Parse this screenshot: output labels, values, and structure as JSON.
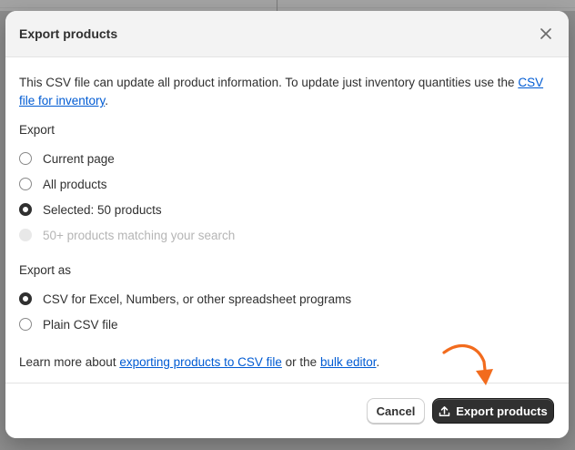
{
  "modal": {
    "title": "Export products",
    "close_icon": "close-icon"
  },
  "intro": {
    "text": "This CSV file can update all product information. To update just inventory quantities use the ",
    "link": "CSV file for inventory",
    "suffix": "."
  },
  "export": {
    "label": "Export",
    "options": [
      {
        "label": "Current page",
        "checked": false,
        "disabled": false
      },
      {
        "label": "All products",
        "checked": false,
        "disabled": false
      },
      {
        "label": "Selected: 50 products",
        "checked": true,
        "disabled": false
      },
      {
        "label": "50+ products matching your search",
        "checked": false,
        "disabled": true
      }
    ]
  },
  "export_as": {
    "label": "Export as",
    "options": [
      {
        "label": "CSV for Excel, Numbers, or other spreadsheet programs",
        "checked": true
      },
      {
        "label": "Plain CSV file",
        "checked": false
      }
    ]
  },
  "learn_more": {
    "prefix": "Learn more about ",
    "link1": "exporting products to CSV file",
    "middle": " or the ",
    "link2": "bulk editor",
    "suffix": "."
  },
  "footer": {
    "cancel_label": "Cancel",
    "export_label": "Export products",
    "export_icon": "upload-icon"
  },
  "annotation": {
    "arrow_color": "#f26b1d"
  }
}
